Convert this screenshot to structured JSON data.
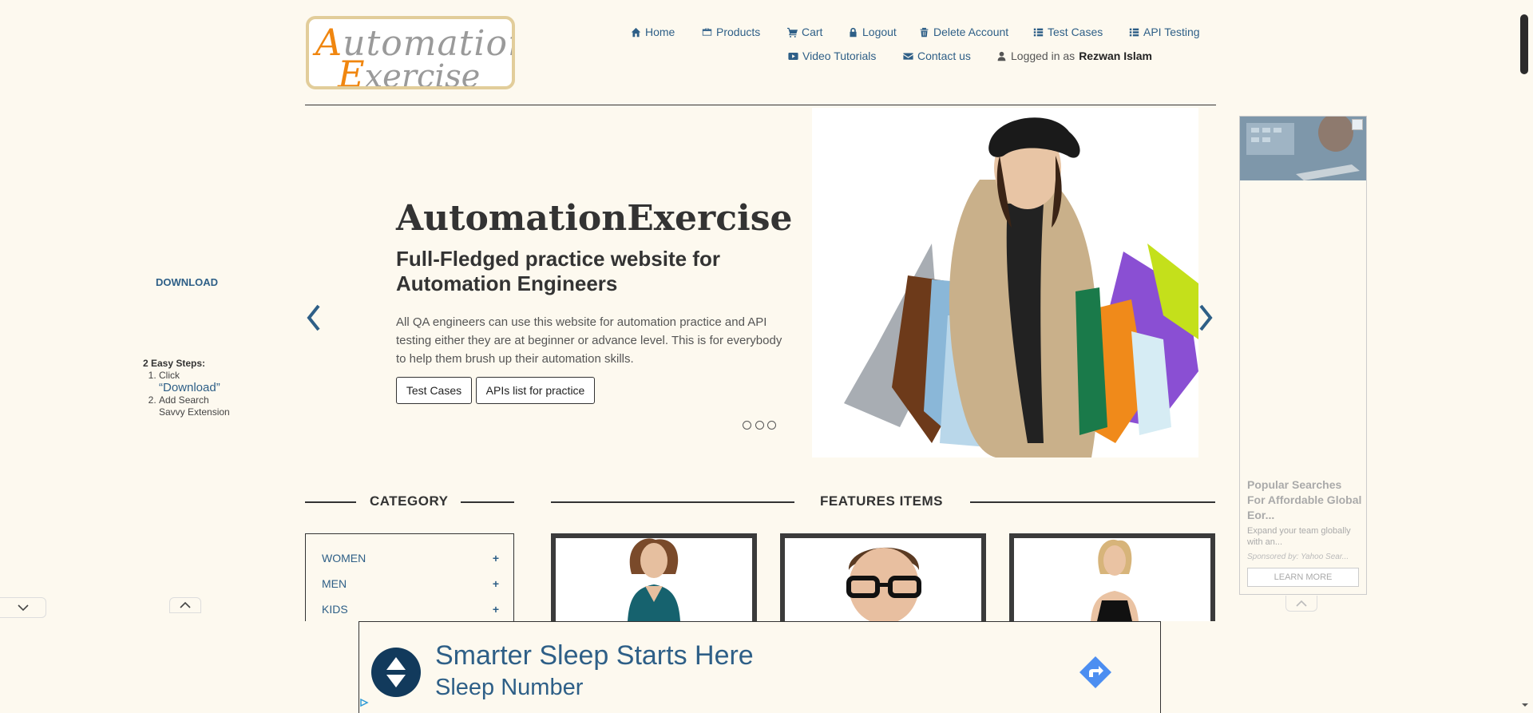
{
  "logo": {
    "line1_cap": "A",
    "line1_rest": "utomation",
    "line2_cap": "E",
    "line2_rest": "xercise"
  },
  "nav": {
    "home": "Home",
    "products": "Products",
    "cart": "Cart",
    "logout": "Logout",
    "delete_account": "Delete Account",
    "test_cases": "Test Cases",
    "api_testing": "API Testing",
    "video_tutorials": "Video Tutorials",
    "contact_us": "Contact us",
    "logged_in_prefix": "Logged in as",
    "username": "Rezwan Islam",
    "icon_color": "#2e5f87"
  },
  "left_ad": {
    "download": "DOWNLOAD",
    "steps_title": "2 Easy Steps:",
    "step1_prefix": "Click",
    "step1_link": "“Download”",
    "step2": "Add Search Savvy Extension"
  },
  "slider": {
    "title": "AutomationExercise",
    "subtitle": "Full-Fledged practice website for Automation Engineers",
    "description": "All QA engineers can use this website for automation practice and API testing either they are at beginner or advance level. This is for everybody to help them brush up their automation skills.",
    "btn_test_cases": "Test Cases",
    "btn_apis": "APIs list for practice",
    "dots": 3
  },
  "category": {
    "heading": "CATEGORY",
    "items": [
      {
        "label": "WOMEN",
        "icon": "+"
      },
      {
        "label": "MEN",
        "icon": "+"
      },
      {
        "label": "KIDS",
        "icon": "+"
      }
    ]
  },
  "features": {
    "heading": "FEATURES ITEMS"
  },
  "right_ad": {
    "title": "Popular Searches For Affordable Global Eor...",
    "description": "Expand your team globally with an...",
    "sponsor": "Sponsored by: Yahoo Sear...",
    "cta": "LEARN MORE"
  },
  "bottom_ad": {
    "headline": "Smarter Sleep Starts Here",
    "brand": "Sleep Number",
    "accent": "#4c8ef1"
  }
}
